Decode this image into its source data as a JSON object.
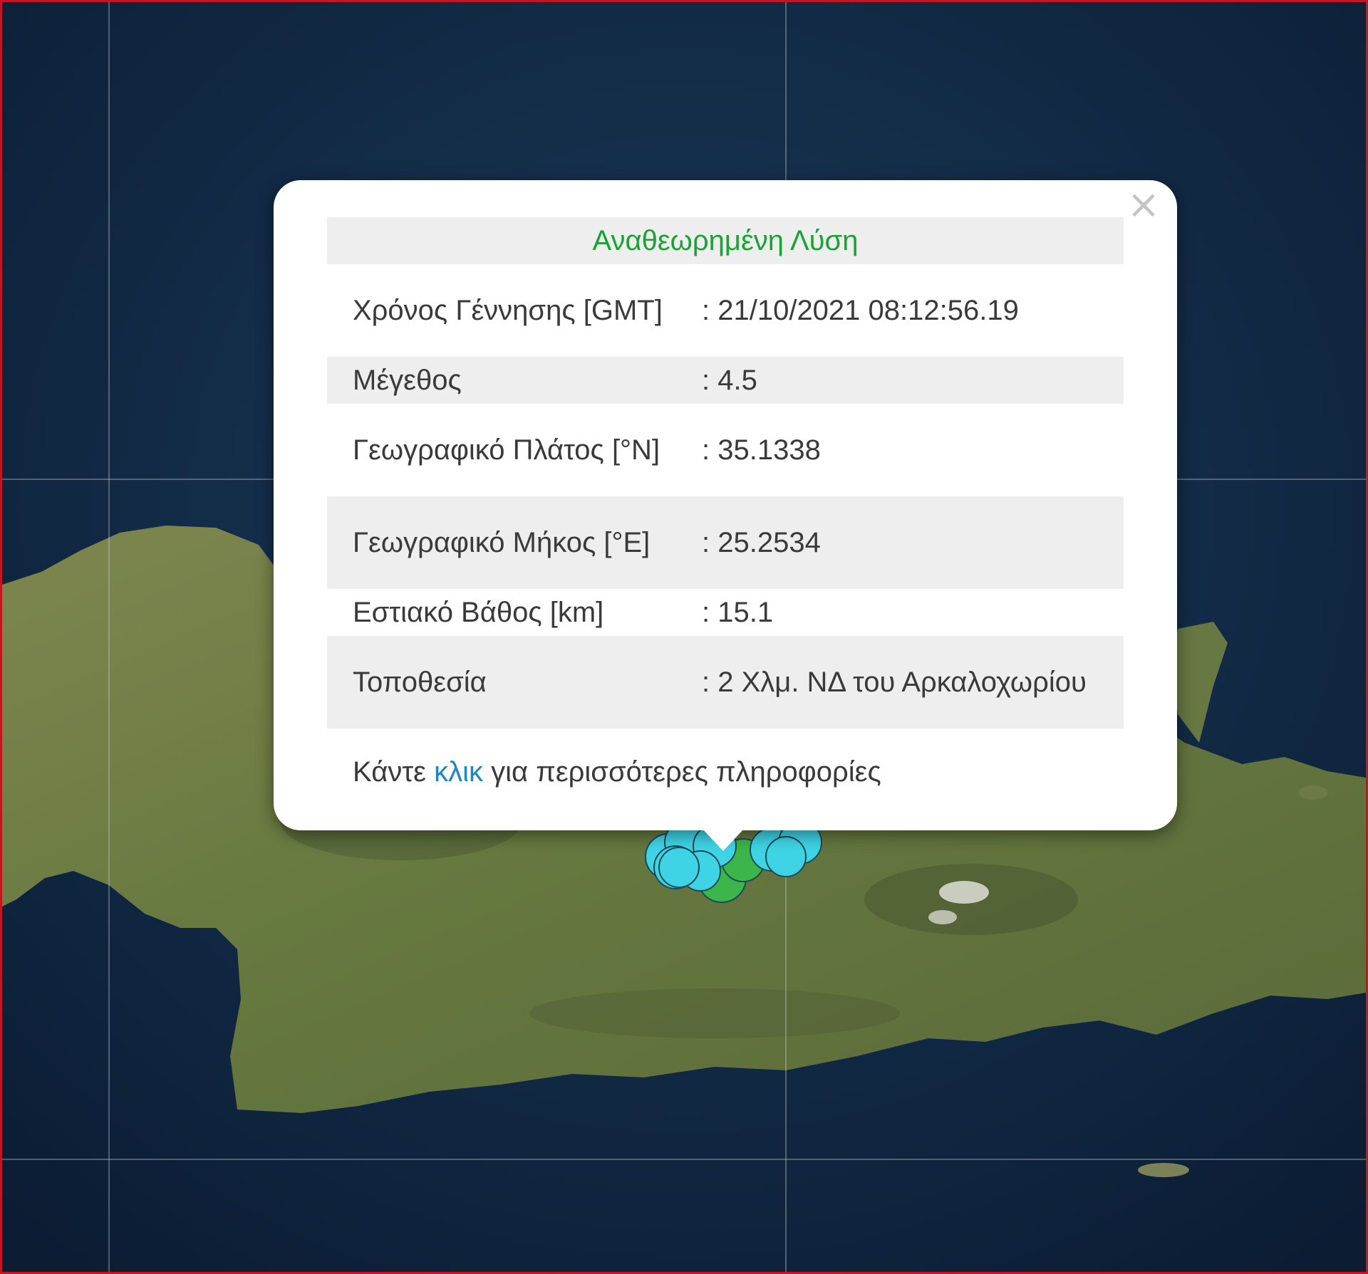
{
  "popup": {
    "title": "Αναθεωρημένη Λύση",
    "rows": [
      {
        "label": "Χρόνος Γέννησης [GMT]",
        "value": ": 21/10/2021 08:12:56.19"
      },
      {
        "label": "Μέγεθος",
        "value": ": 4.5"
      },
      {
        "label": "Γεωγραφικό Πλάτος [°N]",
        "value": ": 35.1338"
      },
      {
        "label": "Γεωγραφικό Μήκος [°E]",
        "value": ": 25.2534"
      },
      {
        "label": "Εστιακό Βάθος [km]",
        "value": ": 15.1"
      },
      {
        "label": "Τοποθεσία",
        "value": ": 2 Χλμ. ΝΔ του Αρκαλοχωρίου"
      }
    ],
    "footer": {
      "prefix": "Κάντε",
      "link": "κλικ",
      "suffix": "για περισσότερες πληροφορίες"
    },
    "close_symbol": "×"
  },
  "colors": {
    "sea": "#10253f",
    "land": "#6b7a44",
    "title_green": "#1aa332",
    "link_blue": "#1d87bf",
    "marker_cyan": "#3ed4e6",
    "marker_green": "#3cb64a",
    "frame_red": "#c8141e"
  },
  "icons": {
    "close": "close-icon"
  }
}
